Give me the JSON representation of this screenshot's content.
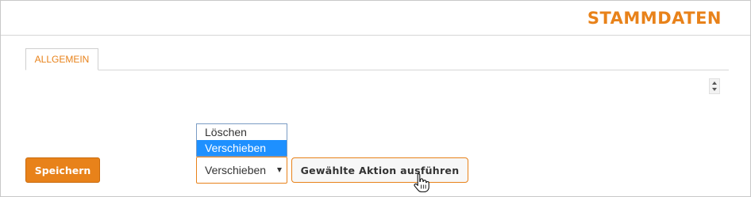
{
  "header": {
    "title": "STAMMDATEN"
  },
  "tabs": [
    {
      "label": "ALLGEMEIN"
    }
  ],
  "form": {
    "save_label": "Speichern",
    "action_select": {
      "selected": "Verschieben",
      "options": [
        "Löschen",
        "Verschieben"
      ],
      "highlighted_option": "Verschieben"
    },
    "run_action_label": "Gewählte Aktion ausführen"
  },
  "colors": {
    "accent": "#e8821a",
    "highlight": "#1e90ff",
    "border": "#d6d6d6"
  },
  "icons": {
    "spinner": "spinner-arrows-icon",
    "select_caret": "caret-down-icon",
    "cursor": "hand-pointer-cursor-icon"
  }
}
